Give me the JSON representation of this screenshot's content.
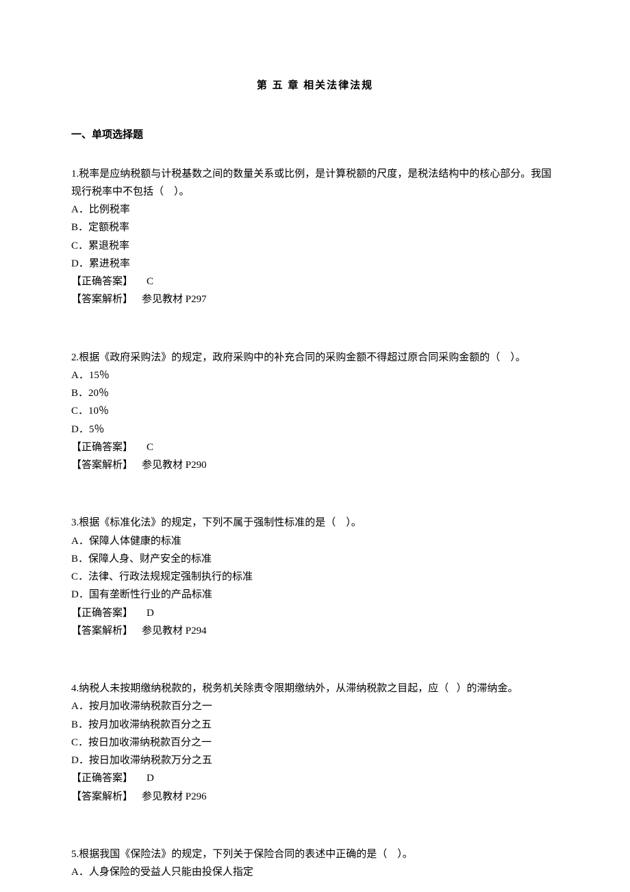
{
  "chapter_title": "第 五 章   相关法律法规",
  "section_title": "一、单项选择题",
  "questions": [
    {
      "stem": "1.税率是应纳税额与计税基数之间的数量关系或比例，是计算税额的尺度，是税法结构中的核心部分。我国现行税率中不包括（    ）。",
      "optA": "A．比例税率",
      "optB": "B．定额税率",
      "optC": "C．累退税率",
      "optD": "D．累进税率",
      "ans_label": "【正确答案】",
      "ans_value": "C",
      "ana_label": "【答案解析】",
      "ana_value": "参见教材 P297"
    },
    {
      "stem": "2.根据《政府采购法》的规定，政府采购中的补充合同的采购金额不得超过原合同采购金额的（    ）。",
      "optA": "A．15％",
      "optB": "B．20％",
      "optC": "C．10％",
      "optD": "D．5％",
      "ans_label": "【正确答案】",
      "ans_value": "C",
      "ana_label": "【答案解析】",
      "ana_value": "参见教材 P290"
    },
    {
      "stem": "3.根据《标准化法》的规定，下列不属于强制性标准的是（    ）。",
      "optA": "A．保障人体健康的标准",
      "optB": "B．保障人身、财产安全的标准",
      "optC": "C．法律、行政法规规定强制执行的标准",
      "optD": "D．国有垄断性行业的产品标准",
      "ans_label": "【正确答案】",
      "ans_value": "D",
      "ana_label": "【答案解析】",
      "ana_value": "参见教材 P294"
    },
    {
      "stem": "4.纳税人未按期缴纳税款的，税务机关除责令限期缴纳外，从滞纳税款之目起，应（   ）的滞纳金。",
      "optA": "A．按月加收滞纳税款百分之一",
      "optB": "B．按月加收滞纳税款百分之五",
      "optC": "C．按日加收滞纳税款百分之一",
      "optD": "D．按日加收滞纳税款万分之五",
      "ans_label": "【正确答案】",
      "ans_value": "D",
      "ana_label": "【答案解析】",
      "ana_value": "参见教材 P296"
    },
    {
      "stem": "5.根据我国《保险法》的规定，下列关于保险合同的表述中正确的是（    ）。",
      "optA": "A．人身保险的受益人只能由投保人指定",
      "optB": "",
      "optC": "",
      "optD": "",
      "ans_label": "",
      "ans_value": "",
      "ana_label": "",
      "ana_value": ""
    }
  ]
}
